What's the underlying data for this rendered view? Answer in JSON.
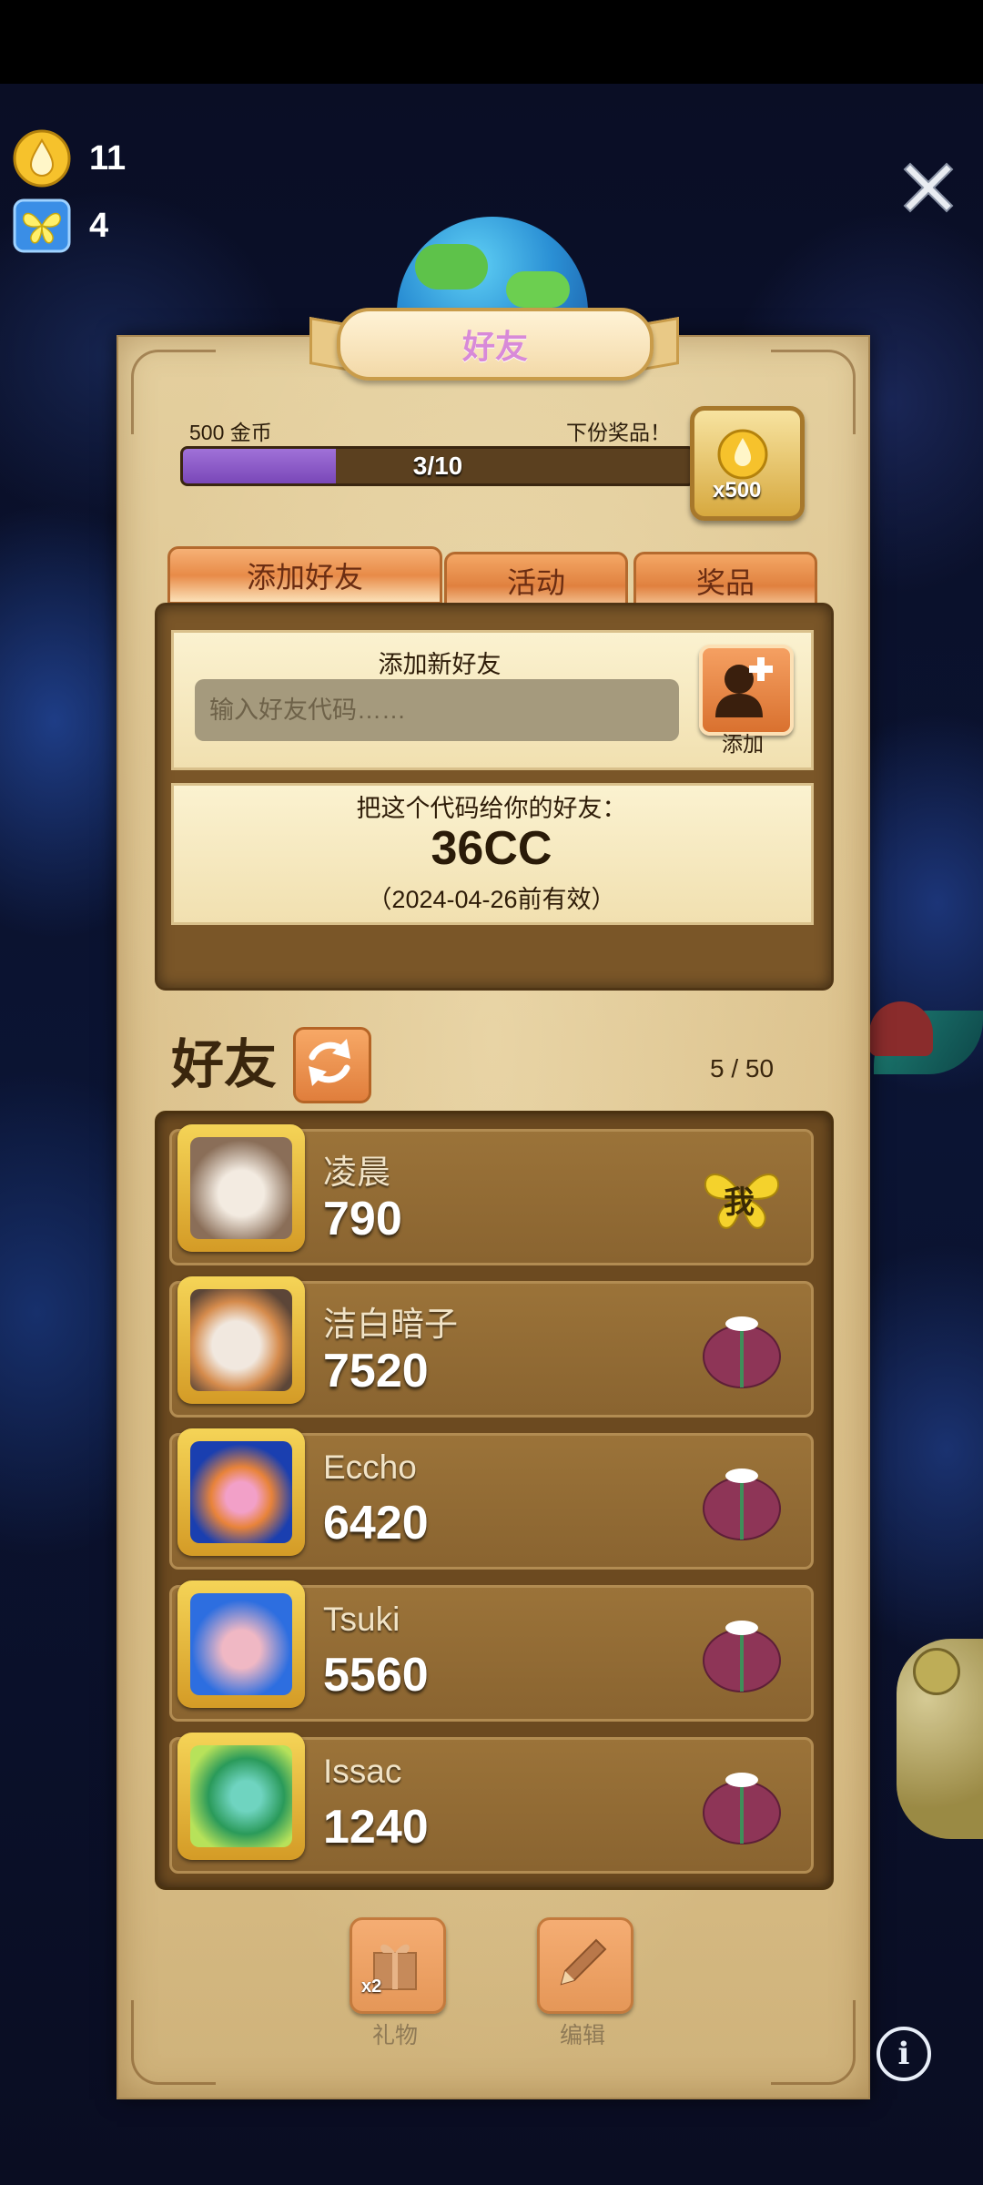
{
  "resources": [
    {
      "icon": "gold-drop-icon",
      "value": "11"
    },
    {
      "icon": "butterfly-icon",
      "value": "4"
    }
  ],
  "panel": {
    "title": "好友"
  },
  "progress": {
    "left_label": "500 金币",
    "right_label": "下份奖品！",
    "current": 3,
    "total": 10,
    "text": "3/10",
    "reward_multiplier": "x500"
  },
  "tabs": [
    {
      "label": "添加好友",
      "active": true
    },
    {
      "label": "活动",
      "active": false
    },
    {
      "label": "奖品",
      "active": false
    }
  ],
  "add_friend": {
    "heading": "添加新好友",
    "input_placeholder": "输入好友代码……",
    "add_label": "添加"
  },
  "share_code": {
    "heading": "把这个代码给你的好友：",
    "code": "36CC",
    "validity": "（2024-04-26前有效）"
  },
  "friends": {
    "title": "好友",
    "count": "5 / 50",
    "list": [
      {
        "name": "凌晨",
        "score": "790",
        "action": "me-badge",
        "action_label": "我"
      },
      {
        "name": "洁白暗子",
        "score": "7520",
        "action": "gift-pouch"
      },
      {
        "name": "Eccho",
        "score": "6420",
        "action": "gift-pouch"
      },
      {
        "name": "Tsuki",
        "score": "5560",
        "action": "gift-pouch"
      },
      {
        "name": "Issac",
        "score": "1240",
        "action": "gift-pouch"
      }
    ]
  },
  "bottom": {
    "gift_label": "礼物",
    "gift_multiplier": "x2",
    "edit_label": "编辑"
  },
  "colors": {
    "accent_orange": "#e0813f",
    "progress_purple": "#8a57c6",
    "panel_parchment": "#dcc28d",
    "list_brown": "#6c4a20"
  }
}
